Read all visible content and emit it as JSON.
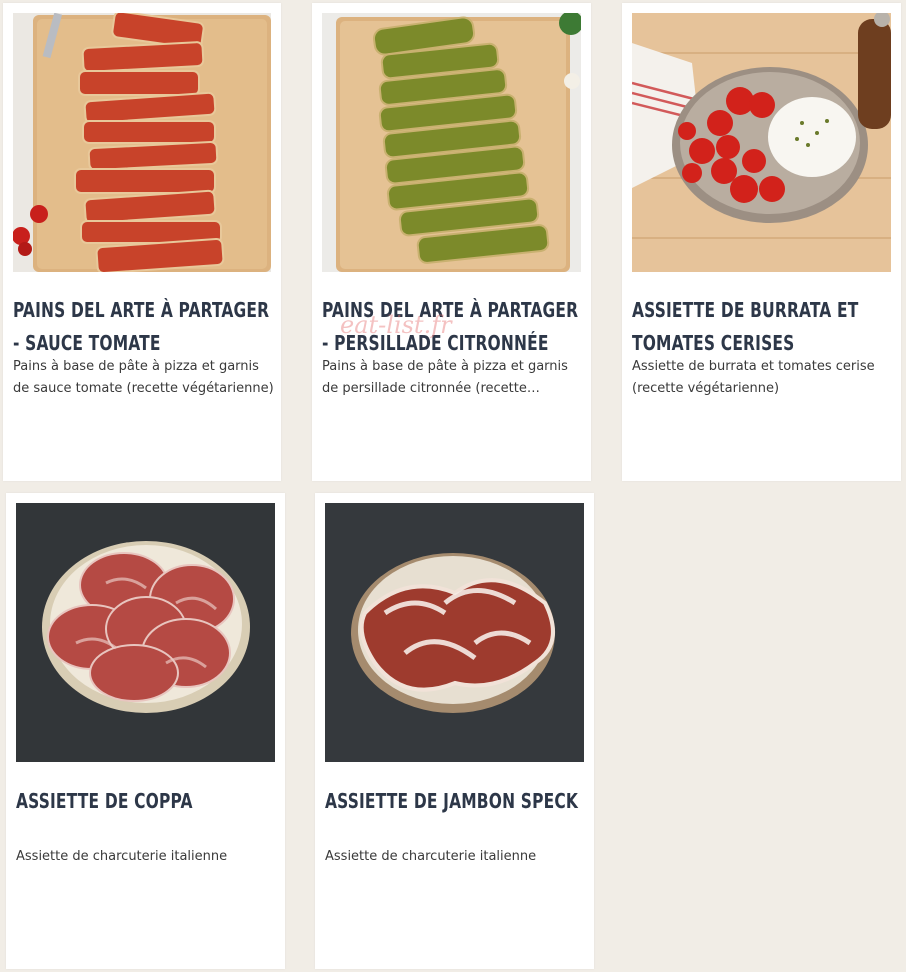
{
  "items": [
    {
      "title_line1": "Pains del Arte à partager",
      "title_line2": "- Sauce tomate",
      "description": "Pains à base de pâte à pizza et garnis de sauce tomate (recette végétarienne)"
    },
    {
      "title_line1": "Pains del Arte à partager",
      "title_line2": "- Persillade citronnée",
      "description": "Pains à base de pâte à pizza et garnis de persillade citronnée (recette…"
    },
    {
      "title_line1": "Assiette de burrata et",
      "title_line2": "tomates cerises",
      "description": "Assiette de burrata et tomates cerise (recette végétarienne)"
    },
    {
      "title_line1": "Assiette de coppa",
      "title_line2": "",
      "description": "Assiette de charcuterie italienne"
    },
    {
      "title_line1": "Assiette de jambon speck",
      "title_line2": "",
      "description": "Assiette de charcuterie italienne"
    }
  ],
  "watermark": "eat-list.fr",
  "colors": {
    "background": "#f1ede6",
    "card": "#ffffff",
    "title": "#2d3748"
  },
  "icons": [
    "tomato-bread-photo",
    "pesto-bread-photo",
    "burrata-photo",
    "coppa-photo",
    "speck-photo"
  ]
}
